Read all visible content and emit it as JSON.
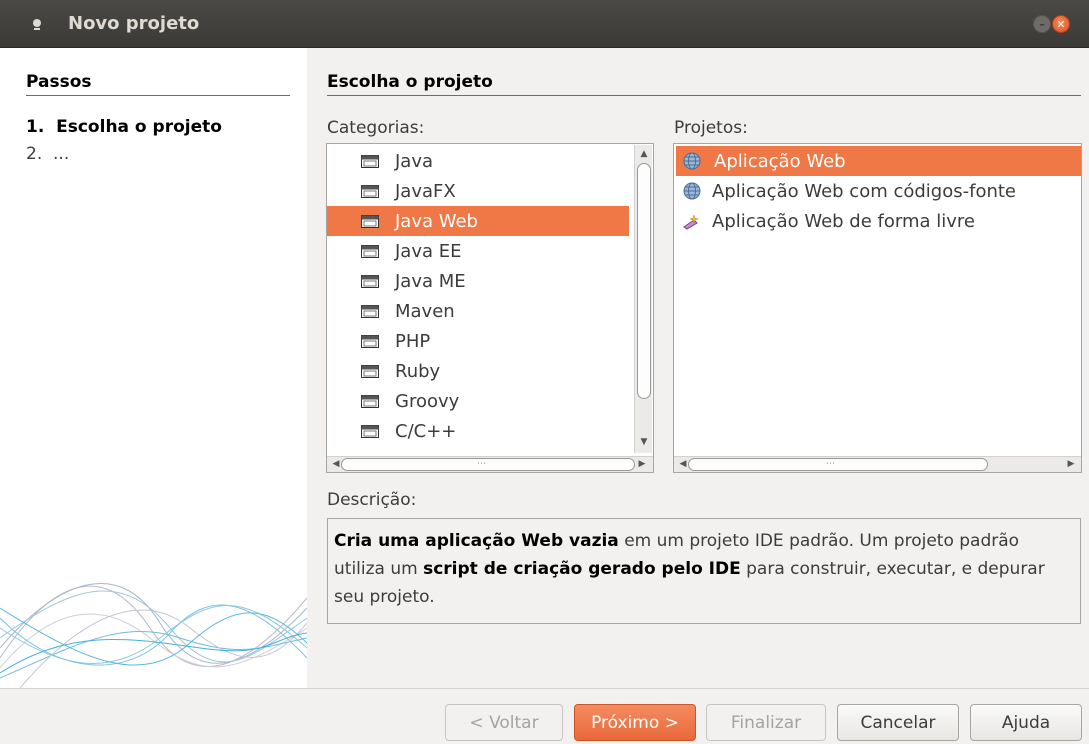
{
  "window": {
    "title": "Novo projeto",
    "min_glyph": "–",
    "close_glyph": "✕"
  },
  "steps": {
    "heading": "Passos",
    "items": [
      "1.  Escolha o projeto",
      "2.  ..."
    ]
  },
  "main": {
    "heading": "Escolha o projeto",
    "categories_label": "Categorias:",
    "projects_label": "Projetos:",
    "description_label": "Descrição:"
  },
  "categories": [
    {
      "label": "Java",
      "icon": "folder-icon"
    },
    {
      "label": "JavaFX",
      "icon": "folder-icon"
    },
    {
      "label": "Java Web",
      "icon": "folder-icon",
      "selected": true
    },
    {
      "label": "Java EE",
      "icon": "folder-icon"
    },
    {
      "label": "Java ME",
      "icon": "folder-icon"
    },
    {
      "label": "Maven",
      "icon": "folder-icon"
    },
    {
      "label": "PHP",
      "icon": "folder-icon"
    },
    {
      "label": "Ruby",
      "icon": "folder-icon"
    },
    {
      "label": "Groovy",
      "icon": "folder-icon"
    },
    {
      "label": "C/C++",
      "icon": "folder-icon"
    }
  ],
  "projects": [
    {
      "label": "Aplicação Web",
      "icon": "globe-icon",
      "selected": true
    },
    {
      "label": "Aplicação Web com códigos-fonte",
      "icon": "globe-icon"
    },
    {
      "label": "Aplicação Web de forma livre",
      "icon": "wand-icon"
    }
  ],
  "description": {
    "part1_bold": "Cria uma aplicação Web vazia",
    "part2": " em um projeto IDE padrão. Um projeto padrão utiliza um ",
    "part3_bold": "script de criação gerado pelo IDE",
    "part4": " para construir, executar, e depurar seu projeto."
  },
  "buttons": {
    "back": "< Voltar",
    "next": "Próximo >",
    "finish": "Finalizar",
    "cancel": "Cancelar",
    "help": "Ajuda"
  },
  "colors": {
    "accent": "#f07746",
    "titlebar": "#3c3b37"
  }
}
